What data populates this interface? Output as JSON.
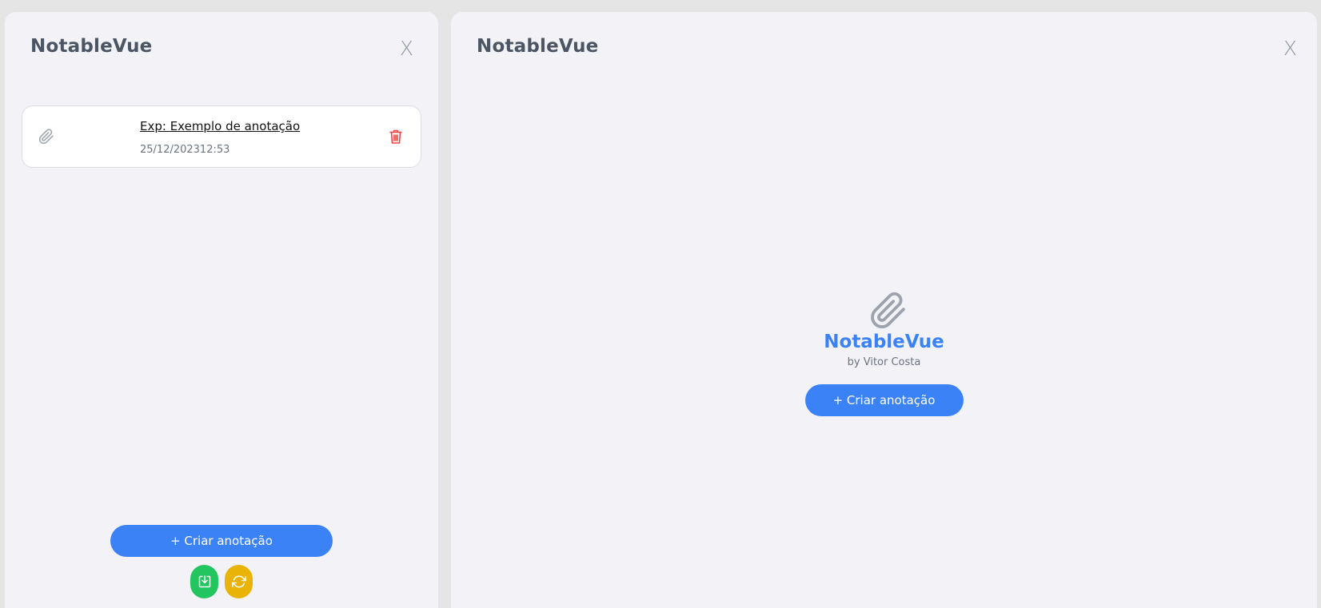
{
  "sidebar": {
    "title": "NotableVue",
    "close_label": "X",
    "notes": [
      {
        "title": "Exp: Exemplo de anotação",
        "date": "25/12/202312:53"
      }
    ],
    "create_label": "+ Criar anotação",
    "actions": [
      {
        "icon": "download-icon",
        "color": "#22c55e"
      },
      {
        "icon": "refresh-icon",
        "color": "#eab308"
      }
    ]
  },
  "main": {
    "title": "NotableVue",
    "close_label": "X",
    "empty_state": {
      "icon": "paperclip-icon",
      "brand": "NotableVue",
      "byline": "by Vitor Costa",
      "create_label": "+ Criar anotação"
    }
  },
  "colors": {
    "background": "#e5e5e5",
    "panel": "#f3f3f7",
    "accent": "#3b82f6",
    "delete": "#ef4444",
    "green": "#22c55e",
    "yellow": "#eab308"
  }
}
